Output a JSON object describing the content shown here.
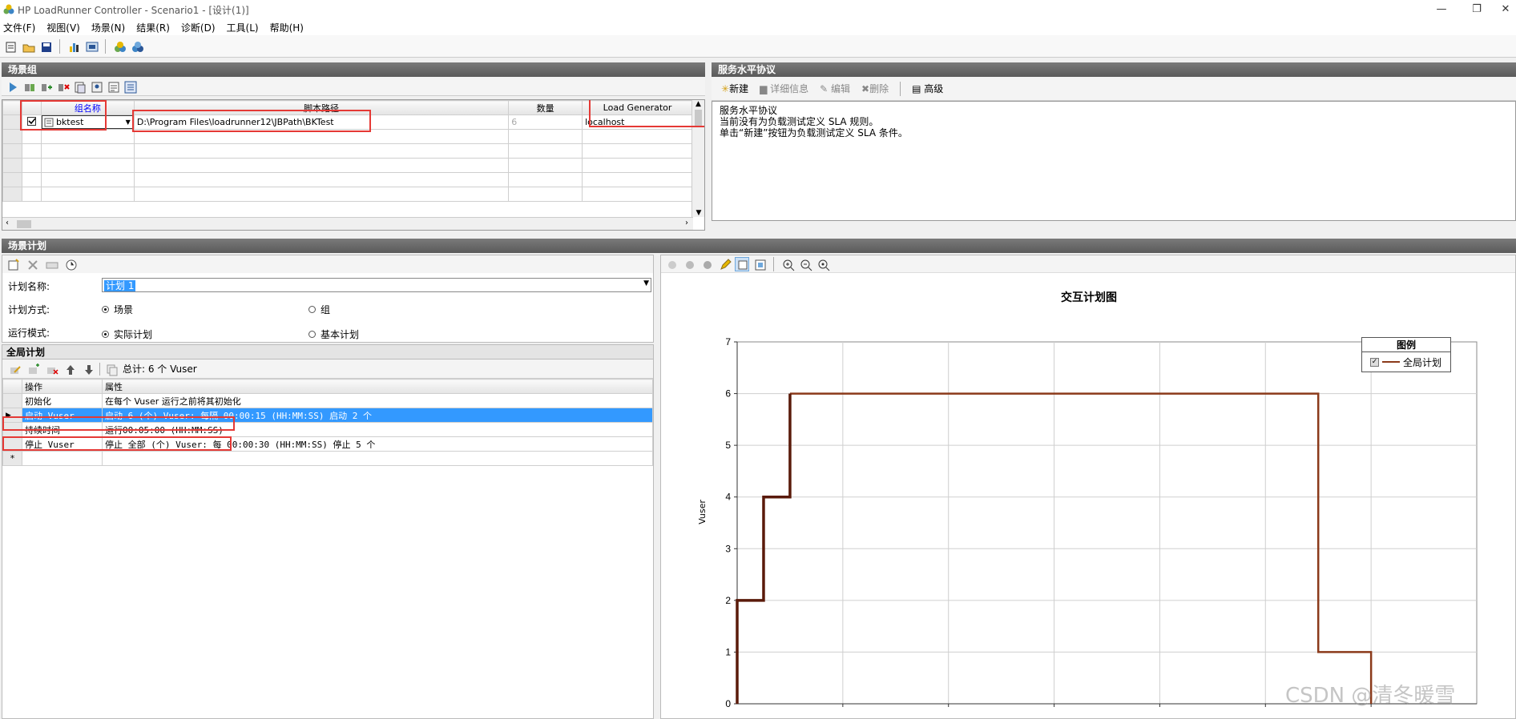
{
  "window": {
    "title": "HP LoadRunner Controller - Scenario1 - [设计(1)]",
    "min": "—",
    "restore": "❐",
    "close": "✕"
  },
  "menu": [
    "文件(F)",
    "视图(V)",
    "场景(N)",
    "结果(R)",
    "诊断(D)",
    "工具(L)",
    "帮助(H)"
  ],
  "scenario_groups": {
    "header": "场景组",
    "columns": [
      "组名称",
      "脚本路径",
      "数量",
      "Load Generator"
    ],
    "rows": [
      {
        "checked": true,
        "name": "bktest",
        "path": "D:\\Program Files\\loadrunner12\\JBPath\\BKTest",
        "qty": "6",
        "lg": "localhost"
      }
    ]
  },
  "sla": {
    "header": "服务水平协议",
    "buttons": [
      "新建",
      "详细信息",
      "编辑",
      "删除",
      "高级"
    ],
    "text": [
      "服务水平协议",
      "当前没有为负载测试定义 SLA 规则。",
      "单击“新建”按钮为负载测试定义 SLA 条件。"
    ]
  },
  "schedule": {
    "header": "场景计划",
    "plan_name_label": "计划名称:",
    "plan_name_value": "计划 1",
    "plan_mode_label": "计划方式:",
    "plan_mode_options": [
      "场景",
      "组"
    ],
    "run_mode_label": "运行模式:",
    "run_mode_options": [
      "实际计划",
      "基本计划"
    ]
  },
  "global_schedule": {
    "header": "全局计划",
    "total": "总计: 6 个 Vuser",
    "columns": [
      "操作",
      "属性"
    ],
    "rows": [
      {
        "op": "初始化",
        "prop": "在每个 Vuser 运行之前将其初始化",
        "selected": false
      },
      {
        "op": "启动 Vuser",
        "prop": "启动 6 (个) Vuser: 每隔 00:00:15 (HH:MM:SS) 启动 2 个",
        "selected": true
      },
      {
        "op": "持续时间",
        "prop": "运行00:05:00 (HH:MM:SS)",
        "selected": false
      },
      {
        "op": "停止 Vuser",
        "prop": "停止 全部 (个) Vuser: 每 00:00:30 (HH:MM:SS) 停止 5 个",
        "selected": false
      }
    ],
    "new_row_marker": "*"
  },
  "chart_data": {
    "type": "line",
    "title": "交互计划图",
    "ylabel": "Vuser",
    "xlabel": "",
    "ylim": [
      0,
      7
    ],
    "yticks": [
      "0",
      "1",
      "2",
      "3",
      "4",
      "5",
      "6",
      "7"
    ],
    "legend_title": "图例",
    "legend_placement": "top-right",
    "grid": true,
    "series": [
      {
        "name": "全局计划",
        "color": "#8b3a1a",
        "dark_color": "#5a1a0a",
        "points_seconds_vusers": [
          [
            0,
            0
          ],
          [
            0,
            2
          ],
          [
            15,
            2
          ],
          [
            15,
            4
          ],
          [
            30,
            4
          ],
          [
            30,
            6
          ],
          [
            330,
            6
          ],
          [
            330,
            1
          ],
          [
            360,
            1
          ],
          [
            360,
            0
          ]
        ]
      }
    ]
  },
  "watermark": "CSDN @清冬暖雪"
}
